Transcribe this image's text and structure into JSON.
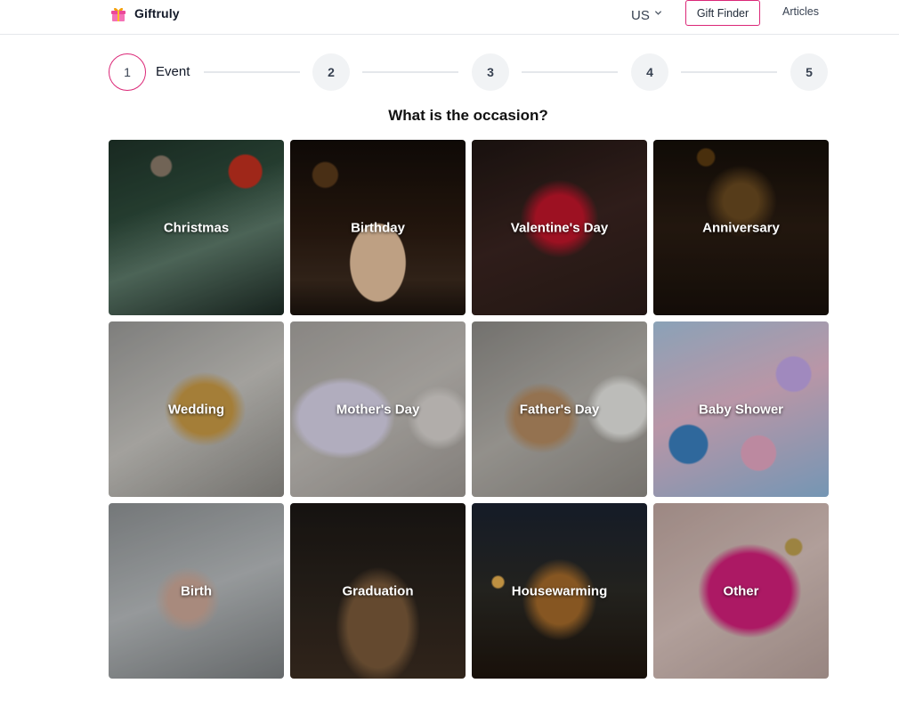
{
  "header": {
    "brand_name": "Giftruly",
    "locale": "US",
    "gift_finder_label": "Gift Finder",
    "articles_label": "Articles"
  },
  "stepper": {
    "steps": [
      "1",
      "2",
      "3",
      "4",
      "5"
    ],
    "active_step_label": "Event"
  },
  "title": "What is the occasion?",
  "occasions": [
    "Christmas",
    "Birthday",
    "Valentine's Day",
    "Anniversary",
    "Wedding",
    "Mother's Day",
    "Father's Day",
    "Baby Shower",
    "Birth",
    "Graduation",
    "Housewarming",
    "Other"
  ],
  "colors": {
    "accent": "#db2777",
    "step_inactive_bg": "#f1f3f5",
    "divider": "#e5e7eb",
    "text": "#111827"
  },
  "icons": {
    "logo": "gift-box-icon",
    "locale_dropdown": "chevron-down-icon"
  }
}
